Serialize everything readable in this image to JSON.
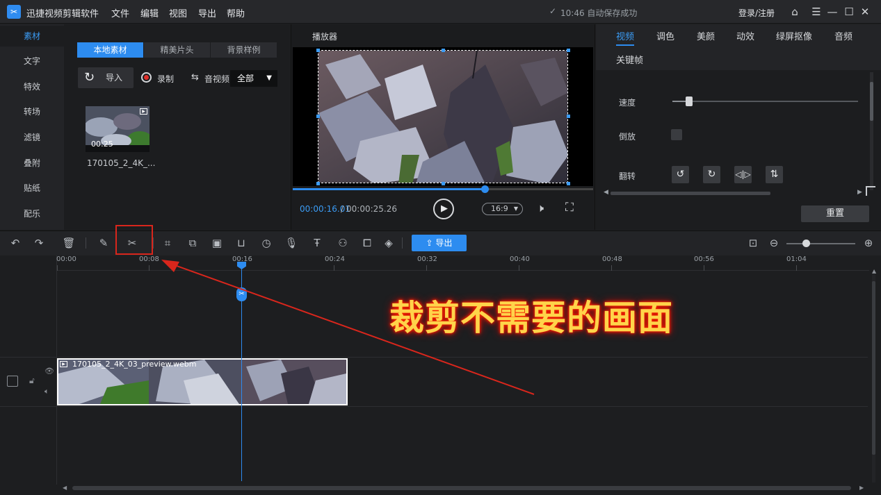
{
  "window": {
    "app_title": "迅捷视频剪辑软件",
    "menu": [
      "文件",
      "编辑",
      "视图",
      "导出",
      "帮助"
    ],
    "autosave_status": "10:46 自动保存成功",
    "login_label": "登录/注册"
  },
  "left_nav": {
    "items": [
      "素材",
      "文字",
      "特效",
      "转场",
      "滤镜",
      "叠附",
      "贴纸",
      "配乐"
    ],
    "active": "素材"
  },
  "media_panel": {
    "tabs": [
      "本地素材",
      "精美片头",
      "背景样例"
    ],
    "import_label": "导入",
    "record_label": "录制",
    "audio_video_label": "音视频",
    "filter_value": "全部",
    "thumbnail": {
      "duration": "00:25",
      "name": "170105_2_4K_..."
    }
  },
  "player": {
    "title": "播放器",
    "current_time": "00:00:16.01",
    "separator": "/",
    "total_time": "00:00:25.26",
    "aspect_ratio": "16:9",
    "progress": 0.64
  },
  "properties": {
    "tabs": [
      "视频",
      "调色",
      "美颜",
      "动效",
      "绿屏抠像",
      "音频"
    ],
    "second_row_tab": "关键帧",
    "active_tab": "视频",
    "speed_label": "速度",
    "speed_level": 0.09,
    "reverse_label": "倒放",
    "flip_label": "翻转",
    "reset_label": "重置"
  },
  "toolbar": {
    "export_label": "导出"
  },
  "timeline": {
    "ruler_ticks": [
      "00:00",
      "00:08",
      "00:16",
      "00:24",
      "00:32",
      "00:40",
      "00:48",
      "00:56",
      "01:04"
    ],
    "clip_name": "170105_2_4K_03_preview.webm",
    "annotation": "裁剪不需要的画面"
  },
  "colors": {
    "accent": "#2d8cf0",
    "highlight_box": "#d9261c",
    "arrow": "#d9261c",
    "annotation_text": "#ffd44a"
  }
}
